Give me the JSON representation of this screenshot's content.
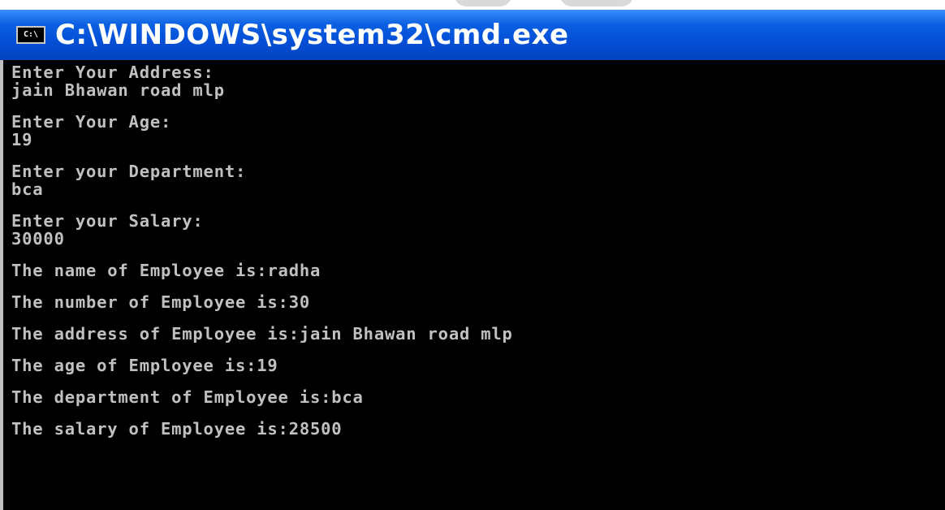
{
  "window": {
    "title": "C:\\WINDOWS\\system32\\cmd.exe",
    "icon_glyph": "C:\\",
    "icon_name": "console-icon"
  },
  "colors": {
    "titlebar": "#0450d8",
    "console_bg": "#000000",
    "console_text": "#c0c0c0"
  },
  "console": {
    "lines": [
      "Enter Your Address:",
      "jain Bhawan road mlp",
      "",
      "Enter Your Age:",
      "19",
      "",
      "Enter your Department:",
      "bca",
      "",
      "Enter your Salary:",
      "30000",
      "",
      "The name of Employee is:radha",
      "",
      "The number of Employee is:30",
      "",
      "The address of Employee is:jain Bhawan road mlp",
      "",
      "The age of Employee is:19",
      "",
      "The department of Employee is:bca",
      "",
      "The salary of Employee is:28500"
    ]
  }
}
